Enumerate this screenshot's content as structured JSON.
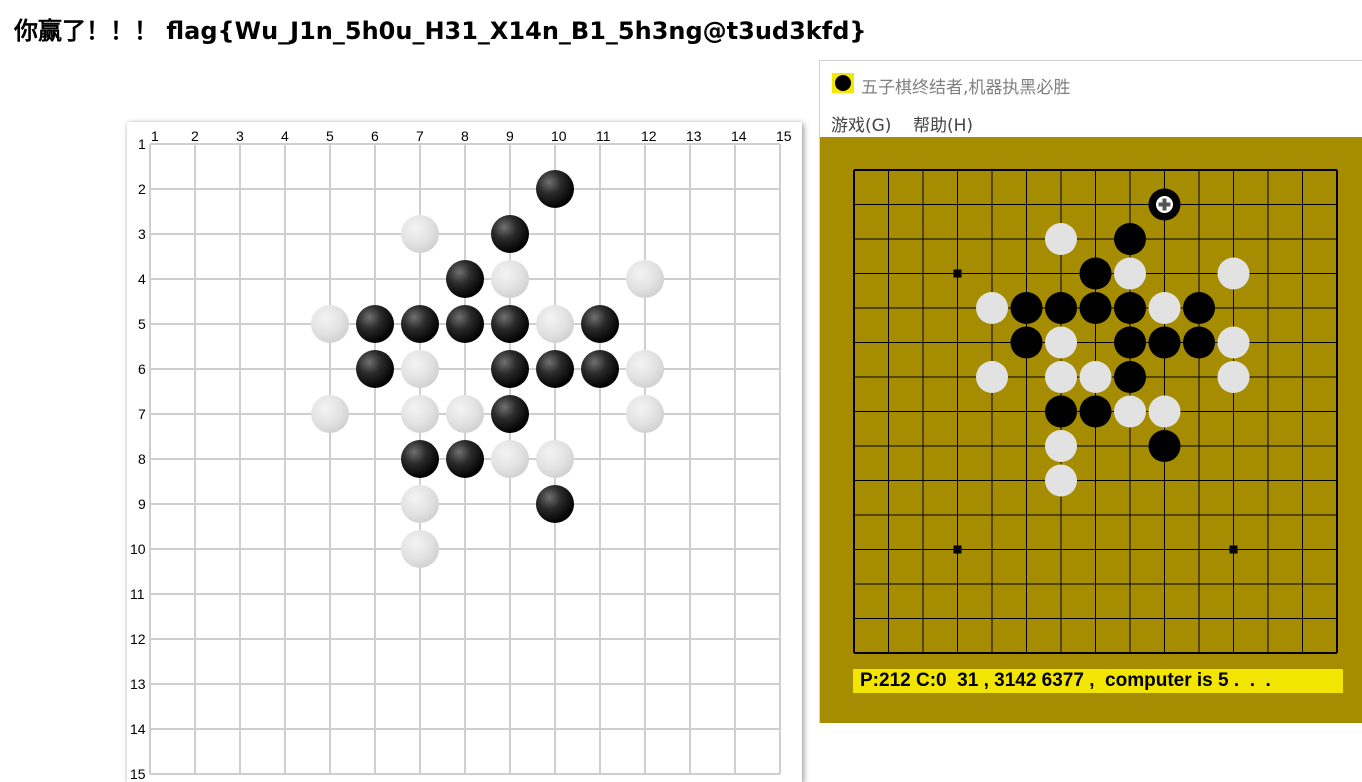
{
  "headline": "你赢了！！！ flag{Wu_J1n_5h0u_H31_X14n_B1_5h3ng@t3ud3kfd}",
  "web_board": {
    "col_labels": [
      "1",
      "2",
      "3",
      "4",
      "5",
      "6",
      "7",
      "8",
      "9",
      "10",
      "11",
      "12",
      "13",
      "14",
      "15"
    ],
    "row_labels": [
      "1",
      "2",
      "3",
      "4",
      "5",
      "6",
      "7",
      "8",
      "9",
      "10",
      "11",
      "12",
      "13",
      "14",
      "15"
    ],
    "stones": [
      {
        "col": 10,
        "row": 2,
        "color": "black"
      },
      {
        "col": 7,
        "row": 3,
        "color": "white"
      },
      {
        "col": 9,
        "row": 3,
        "color": "black"
      },
      {
        "col": 8,
        "row": 4,
        "color": "black"
      },
      {
        "col": 9,
        "row": 4,
        "color": "white"
      },
      {
        "col": 12,
        "row": 4,
        "color": "white"
      },
      {
        "col": 5,
        "row": 5,
        "color": "white"
      },
      {
        "col": 6,
        "row": 5,
        "color": "black"
      },
      {
        "col": 7,
        "row": 5,
        "color": "black"
      },
      {
        "col": 8,
        "row": 5,
        "color": "black"
      },
      {
        "col": 9,
        "row": 5,
        "color": "black"
      },
      {
        "col": 10,
        "row": 5,
        "color": "white"
      },
      {
        "col": 11,
        "row": 5,
        "color": "black"
      },
      {
        "col": 6,
        "row": 6,
        "color": "black"
      },
      {
        "col": 7,
        "row": 6,
        "color": "white"
      },
      {
        "col": 9,
        "row": 6,
        "color": "black"
      },
      {
        "col": 10,
        "row": 6,
        "color": "black"
      },
      {
        "col": 11,
        "row": 6,
        "color": "black"
      },
      {
        "col": 12,
        "row": 6,
        "color": "white"
      },
      {
        "col": 5,
        "row": 7,
        "color": "white"
      },
      {
        "col": 7,
        "row": 7,
        "color": "white"
      },
      {
        "col": 8,
        "row": 7,
        "color": "white"
      },
      {
        "col": 9,
        "row": 7,
        "color": "black"
      },
      {
        "col": 12,
        "row": 7,
        "color": "white"
      },
      {
        "col": 7,
        "row": 8,
        "color": "black"
      },
      {
        "col": 8,
        "row": 8,
        "color": "black"
      },
      {
        "col": 9,
        "row": 8,
        "color": "white"
      },
      {
        "col": 10,
        "row": 8,
        "color": "white"
      },
      {
        "col": 7,
        "row": 9,
        "color": "white"
      },
      {
        "col": 10,
        "row": 9,
        "color": "black"
      },
      {
        "col": 7,
        "row": 10,
        "color": "white"
      }
    ]
  },
  "game_window": {
    "title": "五子棋终结者,机器执黑必胜",
    "icon": "black-stone-icon",
    "menu": [
      {
        "label": "游戏(G)",
        "name": "menu-game"
      },
      {
        "label": "帮助(H)",
        "name": "menu-help"
      }
    ],
    "board_size": 15,
    "star_points": [
      {
        "col": 4,
        "row": 4
      },
      {
        "col": 4,
        "row": 12
      },
      {
        "col": 12,
        "row": 12
      }
    ],
    "last_move": {
      "col": 10,
      "row": 2,
      "marker": "plus-icon"
    },
    "stones": [
      {
        "col": 10,
        "row": 2,
        "color": "black"
      },
      {
        "col": 7,
        "row": 3,
        "color": "white"
      },
      {
        "col": 9,
        "row": 3,
        "color": "black"
      },
      {
        "col": 8,
        "row": 4,
        "color": "black"
      },
      {
        "col": 9,
        "row": 4,
        "color": "white"
      },
      {
        "col": 12,
        "row": 4,
        "color": "white"
      },
      {
        "col": 5,
        "row": 5,
        "color": "white"
      },
      {
        "col": 6,
        "row": 5,
        "color": "black"
      },
      {
        "col": 7,
        "row": 5,
        "color": "black"
      },
      {
        "col": 8,
        "row": 5,
        "color": "black"
      },
      {
        "col": 9,
        "row": 5,
        "color": "black"
      },
      {
        "col": 10,
        "row": 5,
        "color": "white"
      },
      {
        "col": 11,
        "row": 5,
        "color": "black"
      },
      {
        "col": 6,
        "row": 6,
        "color": "black"
      },
      {
        "col": 7,
        "row": 6,
        "color": "white"
      },
      {
        "col": 9,
        "row": 6,
        "color": "black"
      },
      {
        "col": 10,
        "row": 6,
        "color": "black"
      },
      {
        "col": 11,
        "row": 6,
        "color": "black"
      },
      {
        "col": 12,
        "row": 6,
        "color": "white"
      },
      {
        "col": 5,
        "row": 7,
        "color": "white"
      },
      {
        "col": 7,
        "row": 7,
        "color": "white"
      },
      {
        "col": 8,
        "row": 7,
        "color": "white"
      },
      {
        "col": 9,
        "row": 7,
        "color": "black"
      },
      {
        "col": 12,
        "row": 7,
        "color": "white"
      },
      {
        "col": 7,
        "row": 8,
        "color": "black"
      },
      {
        "col": 8,
        "row": 8,
        "color": "black"
      },
      {
        "col": 9,
        "row": 8,
        "color": "white"
      },
      {
        "col": 10,
        "row": 8,
        "color": "white"
      },
      {
        "col": 7,
        "row": 9,
        "color": "white"
      },
      {
        "col": 10,
        "row": 9,
        "color": "black"
      },
      {
        "col": 7,
        "row": 10,
        "color": "white"
      }
    ],
    "status": "P:212 C:0  31 , 3142 6377 ,  computer is 5 .  .  ."
  },
  "colors": {
    "board_bg": "#a58c00",
    "status_bg": "#f2e600",
    "grid_light": "#cfcfcf",
    "stone_black": "#000000",
    "stone_white": "#e2e2e2"
  }
}
